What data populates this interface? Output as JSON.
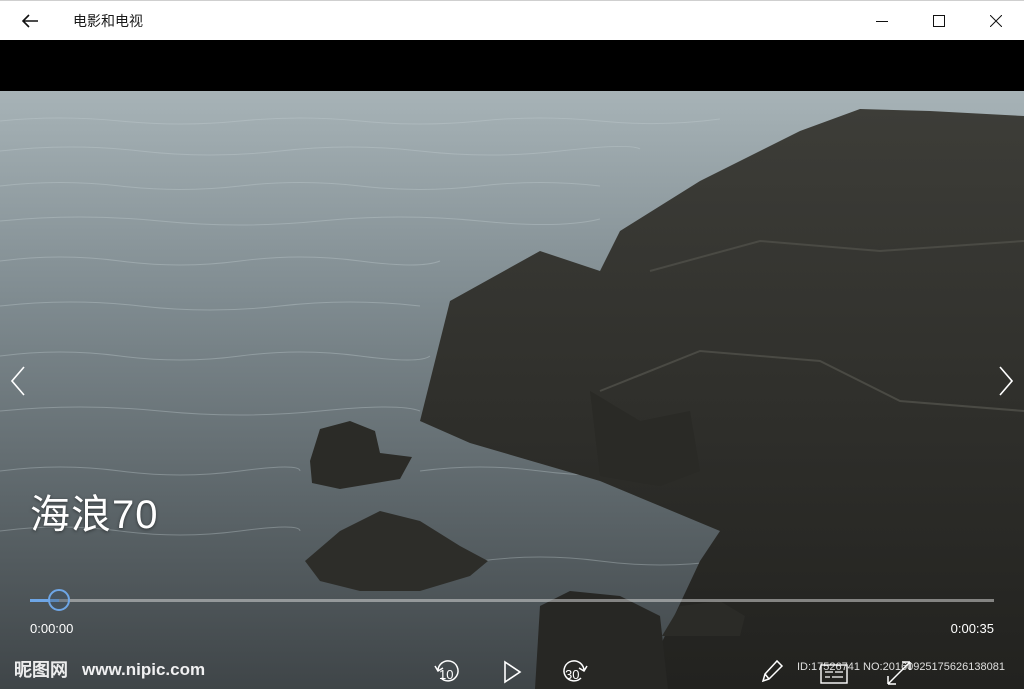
{
  "window": {
    "title": "电影和电视",
    "icons": {
      "back": "arrow-left-icon",
      "minimize": "minimize-icon",
      "maximize": "maximize-icon",
      "close": "close-icon"
    }
  },
  "media": {
    "title": "海浪70",
    "current_time": "0:00:00",
    "total_time": "0:00:35",
    "progress": 0.03
  },
  "controls": {
    "skip_back_seconds": "10",
    "skip_forward_seconds": "30",
    "icons": {
      "prev": "chevron-left-icon",
      "next": "chevron-right-icon",
      "skip_back": "skip-back-icon",
      "play": "play-icon",
      "skip_forward": "skip-forward-icon",
      "edit": "pencil-icon",
      "subtitles": "subtitles-icon",
      "fullscreen": "fullscreen-icon"
    }
  },
  "watermark": {
    "logo": "昵图网",
    "url": "www.nipic.com",
    "id_text": "ID:17526741 NO:20160925175626138081"
  },
  "colors": {
    "accent": "#6ea6e6",
    "titlebar": "#ffffff",
    "letterbox": "#000000"
  }
}
